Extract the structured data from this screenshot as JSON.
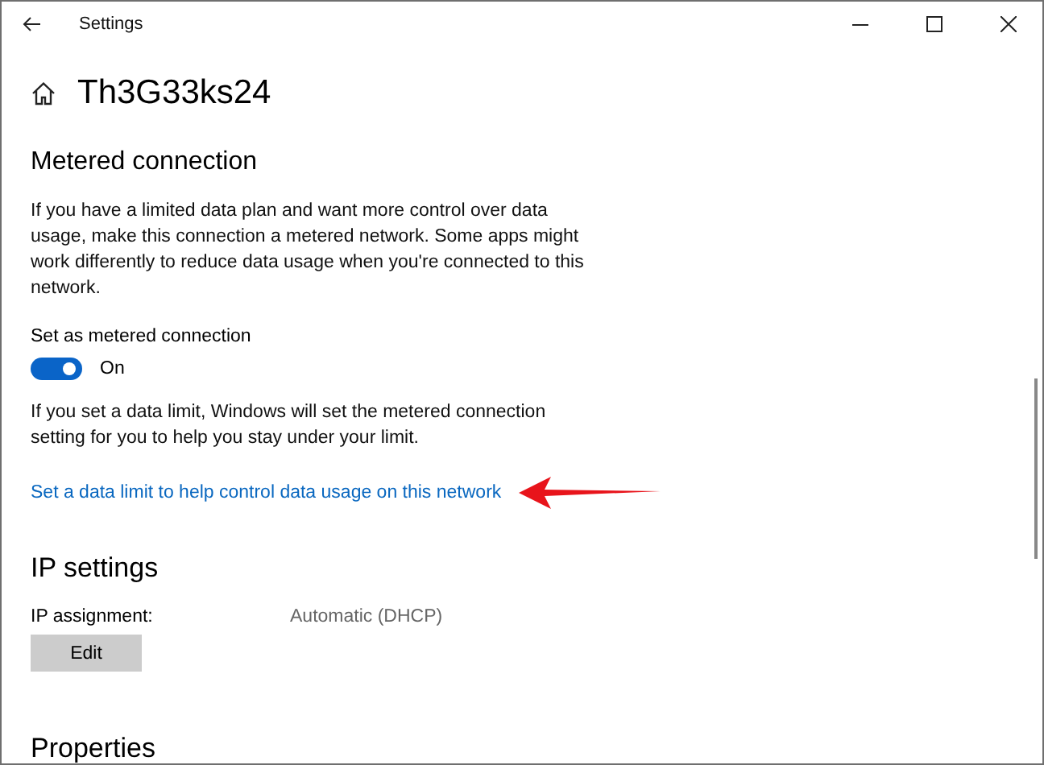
{
  "window": {
    "title": "Settings"
  },
  "page_title": "Th3G33ks24",
  "metered": {
    "heading": "Metered connection",
    "description": "If you have a limited data plan and want more control over data usage, make this connection a metered network. Some apps might work differently to reduce data usage when you're connected to this network.",
    "toggle_label": "Set as metered connection",
    "toggle": {
      "on": true,
      "state_text": "On"
    },
    "limit_note": "If you set a data limit, Windows will set the metered connection setting for you to help you stay under your limit.",
    "link": "Set a data limit to help control data usage on this network"
  },
  "ip_settings": {
    "heading": "IP settings",
    "label": "IP assignment:",
    "value": "Automatic (DHCP)",
    "button": "Edit"
  },
  "properties": {
    "heading": "Properties"
  }
}
